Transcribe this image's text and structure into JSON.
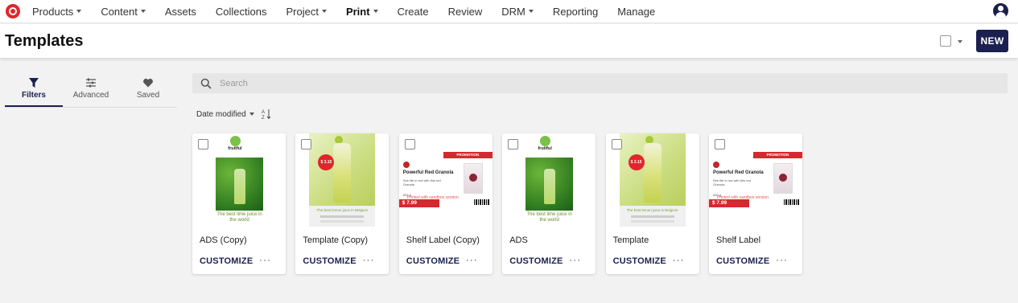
{
  "nav": {
    "items": [
      {
        "label": "Products",
        "dropdown": true
      },
      {
        "label": "Content",
        "dropdown": true
      },
      {
        "label": "Assets",
        "dropdown": false
      },
      {
        "label": "Collections",
        "dropdown": false
      },
      {
        "label": "Project",
        "dropdown": true
      },
      {
        "label": "Print",
        "dropdown": true,
        "active": true
      },
      {
        "label": "Create",
        "dropdown": false
      },
      {
        "label": "Review",
        "dropdown": false
      },
      {
        "label": "DRM",
        "dropdown": true
      },
      {
        "label": "Reporting",
        "dropdown": false
      },
      {
        "label": "Manage",
        "dropdown": false
      }
    ]
  },
  "header": {
    "title": "Templates",
    "new_label": "NEW"
  },
  "left_tabs": [
    {
      "label": "Filters",
      "icon": "filter-icon",
      "active": true
    },
    {
      "label": "Advanced",
      "icon": "sliders-icon",
      "active": false
    },
    {
      "label": "Saved",
      "icon": "heart-icon",
      "active": false
    }
  ],
  "search": {
    "placeholder": "Search",
    "value": ""
  },
  "sort": {
    "label": "Date modified"
  },
  "cards": [
    {
      "name": "ADS (Copy)",
      "art": "ads",
      "action": "CUSTOMIZE",
      "more": "···"
    },
    {
      "name": "Template (Copy)",
      "art": "template",
      "action": "CUSTOMIZE",
      "more": "···"
    },
    {
      "name": "Shelf Label (Copy)",
      "art": "shelf",
      "action": "CUSTOMIZE",
      "more": "···"
    },
    {
      "name": "ADS",
      "art": "ads",
      "action": "CUSTOMIZE",
      "more": "···"
    },
    {
      "name": "Template",
      "art": "template",
      "action": "CUSTOMIZE",
      "more": "···"
    },
    {
      "name": "Shelf Label",
      "art": "shelf",
      "action": "CUSTOMIZE",
      "more": "···"
    }
  ],
  "art": {
    "ads": {
      "brand": "fruitful",
      "tagline": "The best lime juice in the world"
    },
    "template": {
      "price": "$ 3.15",
      "tagline": "The best lemon juice in Belgium"
    },
    "shelf": {
      "promo": "PROMOTION",
      "title": "Powerful Red Granola",
      "text": "See life in red with this red Granola",
      "grams": "500 g",
      "watermark": "Printed with sandbox version",
      "price": "$ 7.99"
    }
  },
  "colors": {
    "brand": "#1b2050",
    "accent": "#e0262b"
  }
}
